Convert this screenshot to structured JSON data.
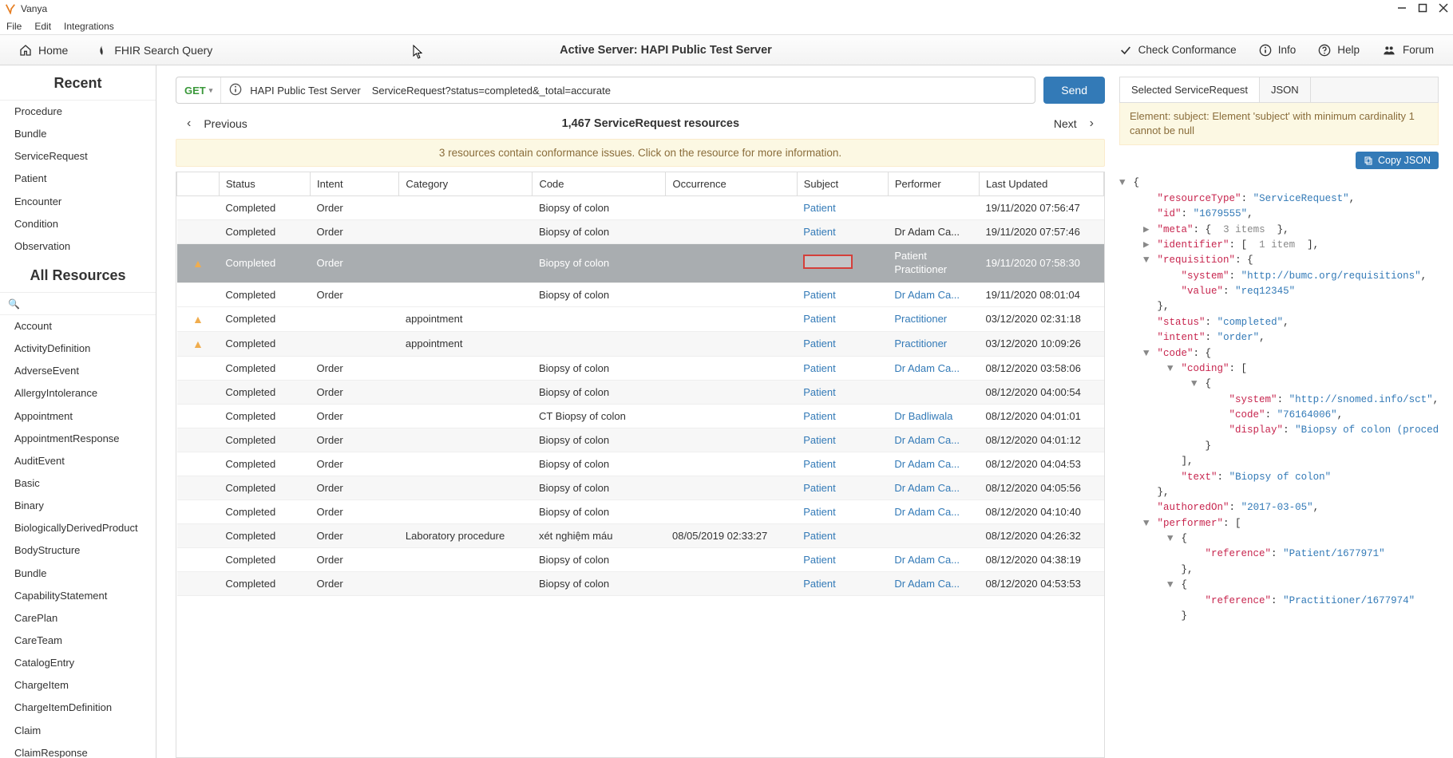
{
  "app": {
    "title": "Vanya"
  },
  "menubar": [
    "File",
    "Edit",
    "Integrations"
  ],
  "toolbar": {
    "home": "Home",
    "fhir_search": "FHIR Search Query",
    "center_prefix": "Active Server: ",
    "center_server": "HAPI Public Test Server",
    "check_conformance": "Check Conformance",
    "info": "Info",
    "help": "Help",
    "forum": "Forum"
  },
  "sidebar": {
    "recent_header": "Recent",
    "recent": [
      "Procedure",
      "Bundle",
      "ServiceRequest",
      "Patient",
      "Encounter",
      "Condition",
      "Observation"
    ],
    "all_header": "All Resources",
    "search_placeholder": "",
    "all": [
      "Account",
      "ActivityDefinition",
      "AdverseEvent",
      "AllergyIntolerance",
      "Appointment",
      "AppointmentResponse",
      "AuditEvent",
      "Basic",
      "Binary",
      "BiologicallyDerivedProduct",
      "BodyStructure",
      "Bundle",
      "CapabilityStatement",
      "CarePlan",
      "CareTeam",
      "CatalogEntry",
      "ChargeItem",
      "ChargeItemDefinition",
      "Claim",
      "ClaimResponse"
    ]
  },
  "urlbar": {
    "method": "GET",
    "server": "HAPI Public Test Server",
    "path": "ServiceRequest?status=completed&_total=accurate",
    "send": "Send"
  },
  "pager": {
    "previous": "Previous",
    "next": "Next",
    "center": "1,467 ServiceRequest resources"
  },
  "banner": "3 resources contain conformance issues. Click on the resource for more information.",
  "columns": [
    "",
    "Status",
    "Intent",
    "Category",
    "Code",
    "Occurrence",
    "Subject",
    "Performer",
    "Last Updated"
  ],
  "rows": [
    {
      "warn": false,
      "status": "Completed",
      "intent": "Order",
      "category": "",
      "code": "Biopsy of colon",
      "occurrence": "",
      "subject": "Patient",
      "subjectLink": true,
      "performer": "",
      "performerLink": false,
      "updated": "19/11/2020 07:56:47",
      "selected": false
    },
    {
      "warn": false,
      "status": "Completed",
      "intent": "Order",
      "category": "",
      "code": "Biopsy of colon",
      "occurrence": "",
      "subject": "Patient",
      "subjectLink": true,
      "performer": "Dr Adam Ca...",
      "performerLink": false,
      "updated": "19/11/2020 07:57:46",
      "selected": false,
      "alt": true
    },
    {
      "warn": true,
      "status": "Completed",
      "intent": "Order",
      "category": "",
      "code": "Biopsy of colon",
      "occurrence": "",
      "subject": "",
      "subjectError": true,
      "performerStack": [
        "Patient",
        "Practitioner"
      ],
      "updated": "19/11/2020 07:58:30",
      "selected": true
    },
    {
      "warn": false,
      "status": "Completed",
      "intent": "Order",
      "category": "",
      "code": "Biopsy of colon",
      "occurrence": "",
      "subject": "Patient",
      "subjectLink": true,
      "performer": "Dr Adam Ca...",
      "performerLink": true,
      "updated": "19/11/2020 08:01:04",
      "selected": false
    },
    {
      "warn": true,
      "status": "Completed",
      "intent": "",
      "category": "appointment",
      "code": "",
      "occurrence": "",
      "subject": "Patient",
      "subjectLink": true,
      "performer": "Practitioner",
      "performerLink": true,
      "updated": "03/12/2020 02:31:18",
      "selected": false
    },
    {
      "warn": true,
      "status": "Completed",
      "intent": "",
      "category": "appointment",
      "code": "",
      "occurrence": "",
      "subject": "Patient",
      "subjectLink": true,
      "performer": "Practitioner",
      "performerLink": true,
      "updated": "03/12/2020 10:09:26",
      "selected": false,
      "alt": true
    },
    {
      "warn": false,
      "status": "Completed",
      "intent": "Order",
      "category": "",
      "code": "Biopsy of colon",
      "occurrence": "",
      "subject": "Patient",
      "subjectLink": true,
      "performer": "Dr Adam Ca...",
      "performerLink": true,
      "updated": "08/12/2020 03:58:06",
      "selected": false
    },
    {
      "warn": false,
      "status": "Completed",
      "intent": "Order",
      "category": "",
      "code": "Biopsy of colon",
      "occurrence": "",
      "subject": "Patient",
      "subjectLink": true,
      "performer": "",
      "performerLink": false,
      "updated": "08/12/2020 04:00:54",
      "selected": false,
      "alt": true
    },
    {
      "warn": false,
      "status": "Completed",
      "intent": "Order",
      "category": "",
      "code": "CT Biopsy of colon",
      "occurrence": "",
      "subject": "Patient",
      "subjectLink": true,
      "performer": "Dr Badliwala",
      "performerLink": true,
      "updated": "08/12/2020 04:01:01",
      "selected": false
    },
    {
      "warn": false,
      "status": "Completed",
      "intent": "Order",
      "category": "",
      "code": "Biopsy of colon",
      "occurrence": "",
      "subject": "Patient",
      "subjectLink": true,
      "performer": "Dr Adam Ca...",
      "performerLink": true,
      "updated": "08/12/2020 04:01:12",
      "selected": false,
      "alt": true
    },
    {
      "warn": false,
      "status": "Completed",
      "intent": "Order",
      "category": "",
      "code": "Biopsy of colon",
      "occurrence": "",
      "subject": "Patient",
      "subjectLink": true,
      "performer": "Dr Adam Ca...",
      "performerLink": true,
      "updated": "08/12/2020 04:04:53",
      "selected": false
    },
    {
      "warn": false,
      "status": "Completed",
      "intent": "Order",
      "category": "",
      "code": "Biopsy of colon",
      "occurrence": "",
      "subject": "Patient",
      "subjectLink": true,
      "performer": "Dr Adam Ca...",
      "performerLink": true,
      "updated": "08/12/2020 04:05:56",
      "selected": false,
      "alt": true
    },
    {
      "warn": false,
      "status": "Completed",
      "intent": "Order",
      "category": "",
      "code": "Biopsy of colon",
      "occurrence": "",
      "subject": "Patient",
      "subjectLink": true,
      "performer": "Dr Adam Ca...",
      "performerLink": true,
      "updated": "08/12/2020 04:10:40",
      "selected": false
    },
    {
      "warn": false,
      "status": "Completed",
      "intent": "Order",
      "category": "Laboratory procedure",
      "code": "xét nghiệm máu",
      "occurrence": "08/05/2019 02:33:27",
      "subject": "Patient",
      "subjectLink": true,
      "performer": "",
      "performerLink": false,
      "updated": "08/12/2020 04:26:32",
      "selected": false,
      "alt": true
    },
    {
      "warn": false,
      "status": "Completed",
      "intent": "Order",
      "category": "",
      "code": "Biopsy of colon",
      "occurrence": "",
      "subject": "Patient",
      "subjectLink": true,
      "performer": "Dr Adam Ca...",
      "performerLink": true,
      "updated": "08/12/2020 04:38:19",
      "selected": false
    },
    {
      "warn": false,
      "status": "Completed",
      "intent": "Order",
      "category": "",
      "code": "Biopsy of colon",
      "occurrence": "",
      "subject": "Patient",
      "subjectLink": true,
      "performer": "Dr Adam Ca...",
      "performerLink": true,
      "updated": "08/12/2020 04:53:53",
      "selected": false,
      "alt": true
    }
  ],
  "right": {
    "tabs": [
      "Selected ServiceRequest",
      "JSON"
    ],
    "error": "Element: subject: Element 'subject' with minimum cardinality 1 cannot be null",
    "copy": "Copy JSON",
    "json_lines": [
      {
        "indent": 0,
        "tri": "down",
        "text": [
          [
            "pun",
            "{"
          ]
        ]
      },
      {
        "indent": 2,
        "text": [
          [
            "key",
            "\"resourceType\""
          ],
          [
            "pun",
            ": "
          ],
          [
            "str",
            "\"ServiceRequest\""
          ],
          [
            "pun",
            ","
          ]
        ]
      },
      {
        "indent": 2,
        "text": [
          [
            "key",
            "\"id\""
          ],
          [
            "pun",
            ": "
          ],
          [
            "str",
            "\"1679555\""
          ],
          [
            "pun",
            ","
          ]
        ]
      },
      {
        "indent": 2,
        "tri": "right",
        "text": [
          [
            "key",
            "\"meta\""
          ],
          [
            "pun",
            ": "
          ],
          [
            "pun",
            "{  "
          ],
          [
            "num",
            "3 items"
          ],
          [
            "pun",
            "  },"
          ]
        ]
      },
      {
        "indent": 2,
        "tri": "right",
        "text": [
          [
            "key",
            "\"identifier\""
          ],
          [
            "pun",
            ": "
          ],
          [
            "pun",
            "[  "
          ],
          [
            "num",
            "1 item"
          ],
          [
            "pun",
            "  ],"
          ]
        ]
      },
      {
        "indent": 2,
        "tri": "down",
        "text": [
          [
            "key",
            "\"requisition\""
          ],
          [
            "pun",
            ": {"
          ]
        ]
      },
      {
        "indent": 4,
        "text": [
          [
            "key",
            "\"system\""
          ],
          [
            "pun",
            ": "
          ],
          [
            "str",
            "\"http://bumc.org/requisitions\""
          ],
          [
            "pun",
            ","
          ]
        ]
      },
      {
        "indent": 4,
        "text": [
          [
            "key",
            "\"value\""
          ],
          [
            "pun",
            ": "
          ],
          [
            "str",
            "\"req12345\""
          ]
        ]
      },
      {
        "indent": 2,
        "text": [
          [
            "pun",
            "},"
          ]
        ]
      },
      {
        "indent": 2,
        "text": [
          [
            "key",
            "\"status\""
          ],
          [
            "pun",
            ": "
          ],
          [
            "str",
            "\"completed\""
          ],
          [
            "pun",
            ","
          ]
        ]
      },
      {
        "indent": 2,
        "text": [
          [
            "key",
            "\"intent\""
          ],
          [
            "pun",
            ": "
          ],
          [
            "str",
            "\"order\""
          ],
          [
            "pun",
            ","
          ]
        ]
      },
      {
        "indent": 2,
        "tri": "down",
        "text": [
          [
            "key",
            "\"code\""
          ],
          [
            "pun",
            ": {"
          ]
        ]
      },
      {
        "indent": 4,
        "tri": "down",
        "text": [
          [
            "key",
            "\"coding\""
          ],
          [
            "pun",
            ": ["
          ]
        ]
      },
      {
        "indent": 6,
        "tri": "down",
        "text": [
          [
            "pun",
            "{"
          ]
        ]
      },
      {
        "indent": 8,
        "text": [
          [
            "key",
            "\"system\""
          ],
          [
            "pun",
            ": "
          ],
          [
            "str",
            "\"http://snomed.info/sct\""
          ],
          [
            "pun",
            ","
          ]
        ]
      },
      {
        "indent": 8,
        "text": [
          [
            "key",
            "\"code\""
          ],
          [
            "pun",
            ": "
          ],
          [
            "str",
            "\"76164006\""
          ],
          [
            "pun",
            ","
          ]
        ]
      },
      {
        "indent": 8,
        "text": [
          [
            "key",
            "\"display\""
          ],
          [
            "pun",
            ": "
          ],
          [
            "str",
            "\"Biopsy of colon (procedure)\""
          ]
        ]
      },
      {
        "indent": 6,
        "text": [
          [
            "pun",
            "}"
          ]
        ]
      },
      {
        "indent": 4,
        "text": [
          [
            "pun",
            "],"
          ]
        ]
      },
      {
        "indent": 4,
        "text": [
          [
            "key",
            "\"text\""
          ],
          [
            "pun",
            ": "
          ],
          [
            "str",
            "\"Biopsy of colon\""
          ]
        ]
      },
      {
        "indent": 2,
        "text": [
          [
            "pun",
            "},"
          ]
        ]
      },
      {
        "indent": 2,
        "text": [
          [
            "key",
            "\"authoredOn\""
          ],
          [
            "pun",
            ": "
          ],
          [
            "str",
            "\"2017-03-05\""
          ],
          [
            "pun",
            ","
          ]
        ]
      },
      {
        "indent": 2,
        "tri": "down",
        "text": [
          [
            "key",
            "\"performer\""
          ],
          [
            "pun",
            ": ["
          ]
        ]
      },
      {
        "indent": 4,
        "tri": "down",
        "text": [
          [
            "pun",
            "{"
          ]
        ]
      },
      {
        "indent": 6,
        "text": [
          [
            "key",
            "\"reference\""
          ],
          [
            "pun",
            ": "
          ],
          [
            "str",
            "\"Patient/1677971\""
          ]
        ]
      },
      {
        "indent": 4,
        "text": [
          [
            "pun",
            "},"
          ]
        ]
      },
      {
        "indent": 4,
        "tri": "down",
        "text": [
          [
            "pun",
            "{"
          ]
        ]
      },
      {
        "indent": 6,
        "text": [
          [
            "key",
            "\"reference\""
          ],
          [
            "pun",
            ": "
          ],
          [
            "str",
            "\"Practitioner/1677974\""
          ]
        ]
      },
      {
        "indent": 4,
        "text": [
          [
            "pun",
            "}"
          ]
        ]
      }
    ]
  }
}
